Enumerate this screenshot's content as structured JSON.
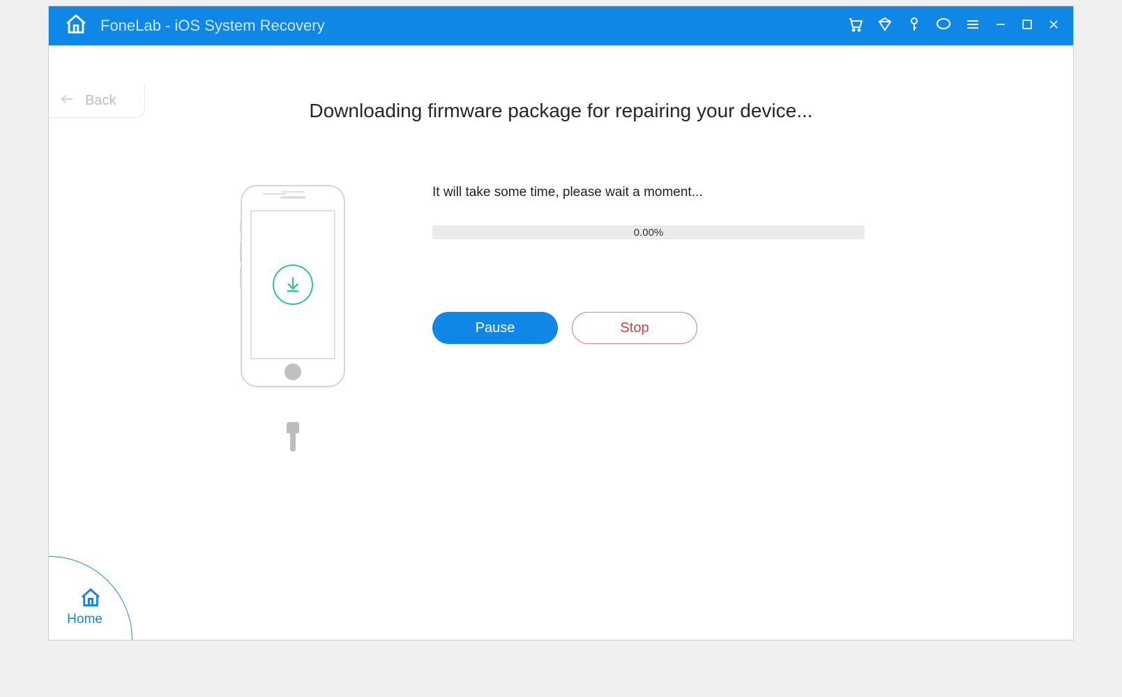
{
  "titlebar": {
    "title": "FoneLab - iOS System Recovery"
  },
  "back": {
    "label": "Back"
  },
  "heading": "Downloading firmware package for repairing your device...",
  "wait_text": "It will take some time, please wait a moment...",
  "progress": {
    "label": "0.00%"
  },
  "buttons": {
    "pause": "Pause",
    "stop": "Stop"
  },
  "home_corner": {
    "label": "Home"
  }
}
